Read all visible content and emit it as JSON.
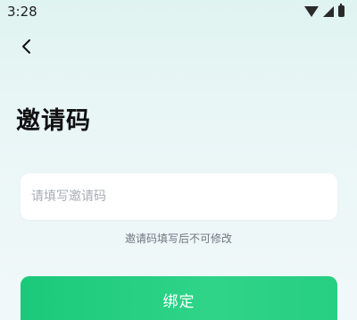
{
  "status_bar": {
    "time": "3:28",
    "icons": [
      "wifi-icon",
      "signal-icon",
      "battery-icon"
    ]
  },
  "header": {
    "back_icon": "chevron-left-icon"
  },
  "main": {
    "title": "邀请码",
    "code_input": {
      "placeholder": "请填写邀请码",
      "value": ""
    },
    "hint": "邀请码填写后不可修改",
    "bind_button_label": "绑定"
  },
  "colors": {
    "accent": "#22cc7f",
    "background_top": "#dff3f1",
    "input_background": "#ffffff",
    "hint_text": "#6f7680",
    "placeholder_text": "#a7adb5"
  }
}
